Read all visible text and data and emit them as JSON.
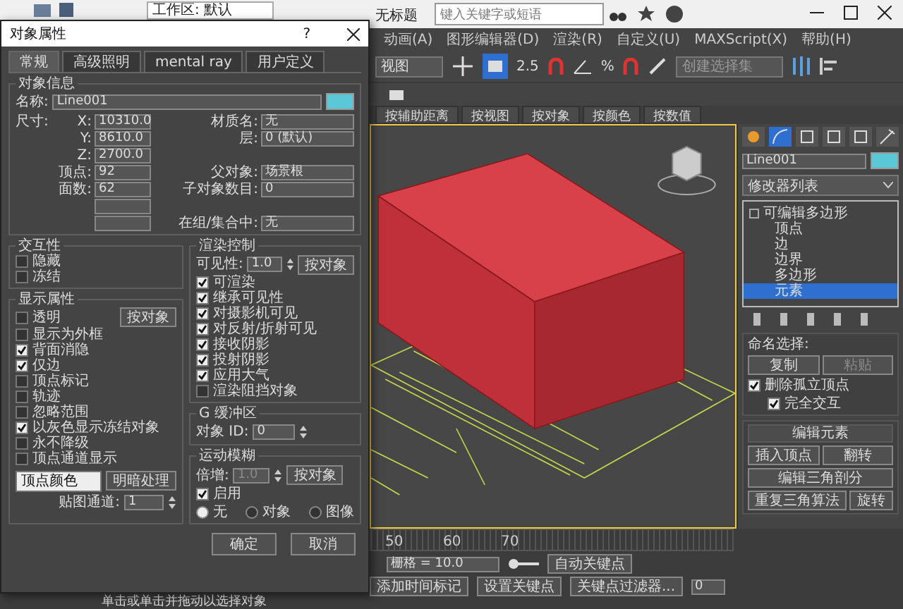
{
  "app": {
    "workspace": "工作区: 默认",
    "title": "无标题",
    "search": {
      "placeholder": "键入关键字或短语"
    },
    "menu": [
      "动画(A)",
      "图形编辑器(D)",
      "渲染(R)",
      "自定义(U)",
      "MAXScript(X)",
      "帮助(H)"
    ],
    "toolbar": {
      "view_select": "视图",
      "snap_label": "2.5",
      "percent_label": "%",
      "selection_set": {
        "placeholder": "创建选择集"
      }
    },
    "snap_buttons": [
      "按辅助距离",
      "按视图",
      "按对象",
      "按颜色",
      "按数值"
    ],
    "timeline": {
      "ticks": [
        "50",
        "60",
        "70"
      ]
    },
    "status": {
      "grid": "栅格 = 10.0",
      "auto_key": "自动关键点",
      "set_key": "设置关键点",
      "key_filters": "关键点过滤器...",
      "add_time_tag": "添加时间标记",
      "frame": "0",
      "prompt": "单击或单击并拖动以选择对象"
    }
  },
  "command_panel": {
    "object_name": "Line001",
    "modifier_list": "修改器列表",
    "stack": [
      {
        "label": "可编辑多边形",
        "selected": false,
        "expanded": true,
        "children": [
          {
            "label": "顶点",
            "selected": false
          },
          {
            "label": "边",
            "selected": false
          },
          {
            "label": "边界",
            "selected": false
          },
          {
            "label": "多边形",
            "selected": false
          },
          {
            "label": "元素",
            "selected": true
          }
        ]
      }
    ],
    "named_selections": {
      "title": "命名选择:",
      "buttons": [
        {
          "label": "复制",
          "disabled": false
        },
        {
          "label": "粘贴",
          "disabled": true
        }
      ],
      "checks": [
        {
          "label": "删除孤立顶点",
          "checked": true
        },
        {
          "label": "完全交互",
          "checked": true
        }
      ]
    },
    "edit_elements": {
      "title": "编辑元素",
      "buttons": [
        "插入顶点",
        "翻转",
        "编辑三角剖分",
        "重复三角算法",
        "旋转"
      ]
    }
  },
  "dialog": {
    "title": "对象属性",
    "help": "?",
    "tabs": [
      {
        "label": "常规",
        "selected": true
      },
      {
        "label": "高级照明",
        "selected": false
      },
      {
        "label": "mental ray",
        "selected": false
      },
      {
        "label": "用户定义",
        "selected": false
      }
    ],
    "info": {
      "title": "对象信息",
      "name_label": "名称:",
      "name": "Line001",
      "size_label": "尺寸:",
      "left_fields": [
        {
          "label": "X:",
          "value": "10310.0"
        },
        {
          "label": "Y:",
          "value": "8610.0"
        },
        {
          "label": "Z:",
          "value": "2700.0"
        },
        {
          "label": "顶点:",
          "value": "92"
        },
        {
          "label": "面数:",
          "value": "62"
        }
      ],
      "right_fields": [
        {
          "label": "材质名:",
          "value": "无"
        },
        {
          "label": "层:",
          "value": "0 (默认)"
        },
        {
          "label": "父对象:",
          "value": "场景根"
        },
        {
          "label": "子对象数目:",
          "value": "0"
        },
        {
          "label": "在组/集合中:",
          "value": "无"
        }
      ]
    },
    "interaction": {
      "title": "交互性",
      "checks": [
        {
          "label": "隐藏",
          "checked": false
        },
        {
          "label": "冻结",
          "checked": false
        }
      ]
    },
    "display": {
      "title": "显示属性",
      "by_object": "按对象",
      "checks": [
        {
          "label": "透明",
          "checked": false
        },
        {
          "label": "显示为外框",
          "checked": false
        },
        {
          "label": "背面消隐",
          "checked": true
        },
        {
          "label": "仅边",
          "checked": true
        },
        {
          "label": "顶点标记",
          "checked": false
        },
        {
          "label": "轨迹",
          "checked": false
        },
        {
          "label": "忽略范围",
          "checked": false
        },
        {
          "label": "以灰色显示冻结对象",
          "checked": true
        },
        {
          "label": "永不降级",
          "checked": false
        },
        {
          "label": "顶点通道显示",
          "checked": false
        }
      ],
      "color_mode": "顶点颜色",
      "shading": "明暗处理",
      "map_channel": {
        "label": "贴图通道:",
        "value": "1"
      }
    },
    "render": {
      "title": "渲染控制",
      "visibility": {
        "label": "可见性:",
        "value": "1.0"
      },
      "by_object": "按对象",
      "checks": [
        {
          "label": "可渲染",
          "checked": true
        },
        {
          "label": "继承可见性",
          "checked": true
        },
        {
          "label": "对摄影机可见",
          "checked": true
        },
        {
          "label": "对反射/折射可见",
          "checked": true
        },
        {
          "label": "接收阴影",
          "checked": true
        },
        {
          "label": "投射阴影",
          "checked": true
        },
        {
          "label": "应用大气",
          "checked": true
        },
        {
          "label": "渲染阻挡对象",
          "checked": false
        }
      ]
    },
    "gbuffer": {
      "title": "G 缓冲区",
      "object_id": {
        "label": "对象 ID:",
        "value": "0"
      }
    },
    "motion_blur": {
      "title": "运动模糊",
      "multiplier": {
        "label": "倍增:",
        "value": "1.0",
        "disabled": true
      },
      "by_object": "按对象",
      "enabled": {
        "label": "启用",
        "checked": true
      },
      "modes": [
        {
          "label": "无",
          "selected": true
        },
        {
          "label": "对象",
          "selected": false
        },
        {
          "label": "图像",
          "selected": false
        }
      ]
    },
    "buttons": [
      "确定",
      "取消"
    ]
  }
}
